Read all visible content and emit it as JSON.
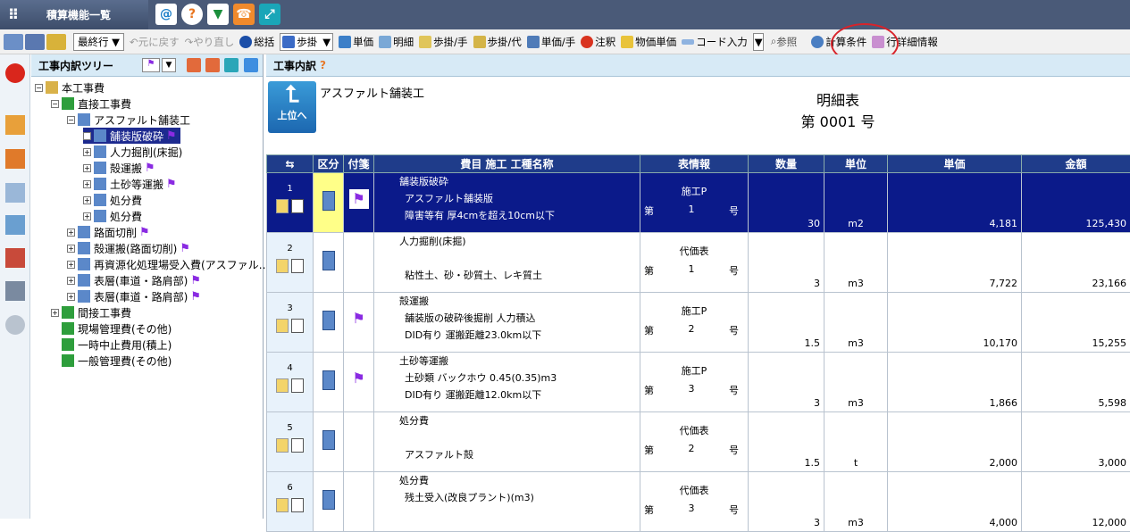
{
  "app": {
    "title": "積算機能一覧"
  },
  "quick_icons": [
    "at-icon",
    "help-icon",
    "beginner-icon",
    "support-icon",
    "expand-icon"
  ],
  "toolbar": {
    "last_row": "最終行 ▼",
    "undo": "元に戻す",
    "redo": "やり直し",
    "total": "総括",
    "step": "歩掛",
    "unit_price": "単価",
    "detail": "明細",
    "step_hand": "歩掛/手",
    "step_sub": "歩掛/代",
    "unit_hand": "単価/手",
    "note": "注釈",
    "material_price": "物価単価",
    "code_input": "コード入力",
    "reference": "参照",
    "calc_conditions": "計算条件",
    "row_detail": "行詳細情報"
  },
  "tree": {
    "title": "工事内訳ツリー",
    "nodes": [
      {
        "label": "本工事費",
        "level": 0,
        "pm": "−"
      },
      {
        "label": "直接工事費",
        "level": 1,
        "pm": "−"
      },
      {
        "label": "アスファルト舗装工",
        "level": 2,
        "pm": "−"
      },
      {
        "label": "舗装版破砕",
        "level": 3,
        "pm": "+",
        "flag": true,
        "selected": true
      },
      {
        "label": "人力掘削(床掘)",
        "level": 3,
        "pm": "+"
      },
      {
        "label": "殻運搬",
        "level": 3,
        "pm": "+",
        "flag": true
      },
      {
        "label": "土砂等運搬",
        "level": 3,
        "pm": "+",
        "flag": true
      },
      {
        "label": "処分費",
        "level": 3,
        "pm": "+"
      },
      {
        "label": "処分費",
        "level": 3,
        "pm": "+"
      },
      {
        "label": "路面切削",
        "level": 2,
        "pm": "+",
        "flag": true
      },
      {
        "label": "殻運搬(路面切削)",
        "level": 2,
        "pm": "+",
        "flag": true
      },
      {
        "label": "再資源化処理場受入費(アスファル…",
        "level": 2,
        "pm": "+"
      },
      {
        "label": "表層(車道・路肩部)",
        "level": 2,
        "pm": "+",
        "flag": true
      },
      {
        "label": "表層(車道・路肩部)",
        "level": 2,
        "pm": "+",
        "flag": true
      },
      {
        "label": "間接工事費",
        "level": 1,
        "pm": "+"
      },
      {
        "label": "現場管理費(その他)",
        "level": 1,
        "pm": ""
      },
      {
        "label": "一時中止費用(積上)",
        "level": 1,
        "pm": ""
      },
      {
        "label": "一般管理費(その他)",
        "level": 1,
        "pm": ""
      }
    ]
  },
  "main": {
    "title": "工事内訳",
    "up_label": "上位へ",
    "work_name": "アスファルト舗装工",
    "sheet_title": "明細表",
    "sheet_no": "第 0001 号"
  },
  "table": {
    "headers": [
      "⇆",
      "区分",
      "付箋",
      "費目 施工 工種名称",
      "表情報",
      "数量",
      "単位",
      "単価",
      "金額"
    ],
    "rows": [
      {
        "n": "1",
        "lines": [
          "舗装版破砕",
          "アスファルト舗装版",
          "障害等有 厚4cmを超え10cm以下"
        ],
        "info": "施工P",
        "dai": "第",
        "no": "1",
        "go": "号",
        "qty": "30",
        "unit": "m2",
        "price": "4,181",
        "amount": "125,430",
        "flag": true,
        "sel": true
      },
      {
        "n": "2",
        "lines": [
          "人力掘削(床掘)",
          "",
          "粘性土、砂・砂質土、レキ質土"
        ],
        "info": "代価表",
        "dai": "第",
        "no": "1",
        "go": "号",
        "qty": "3",
        "unit": "m3",
        "price": "7,722",
        "amount": "23,166",
        "flag": false
      },
      {
        "n": "3",
        "lines": [
          "殻運搬",
          "舗装版の破砕後掘削 人力積込",
          "DID有り 運搬距離23.0km以下"
        ],
        "info": "施工P",
        "dai": "第",
        "no": "2",
        "go": "号",
        "qty": "1.5",
        "unit": "m3",
        "price": "10,170",
        "amount": "15,255",
        "flag": true
      },
      {
        "n": "4",
        "lines": [
          "土砂等運搬",
          "土砂類 バックホウ 0.45(0.35)m3",
          "DID有り 運搬距離12.0km以下"
        ],
        "info": "施工P",
        "dai": "第",
        "no": "3",
        "go": "号",
        "qty": "3",
        "unit": "m3",
        "price": "1,866",
        "amount": "5,598",
        "flag": true
      },
      {
        "n": "5",
        "lines": [
          "処分費",
          "",
          "アスファルト殻"
        ],
        "info": "代価表",
        "dai": "第",
        "no": "2",
        "go": "号",
        "qty": "1.5",
        "unit": "t",
        "price": "2,000",
        "amount": "3,000",
        "flag": false
      },
      {
        "n": "6",
        "lines": [
          "処分費",
          "残土受入(改良プラント)(m3)",
          ""
        ],
        "info": "代価表",
        "dai": "第",
        "no": "3",
        "go": "号",
        "qty": "3",
        "unit": "m3",
        "price": "4,000",
        "amount": "12,000",
        "flag": false
      }
    ]
  }
}
